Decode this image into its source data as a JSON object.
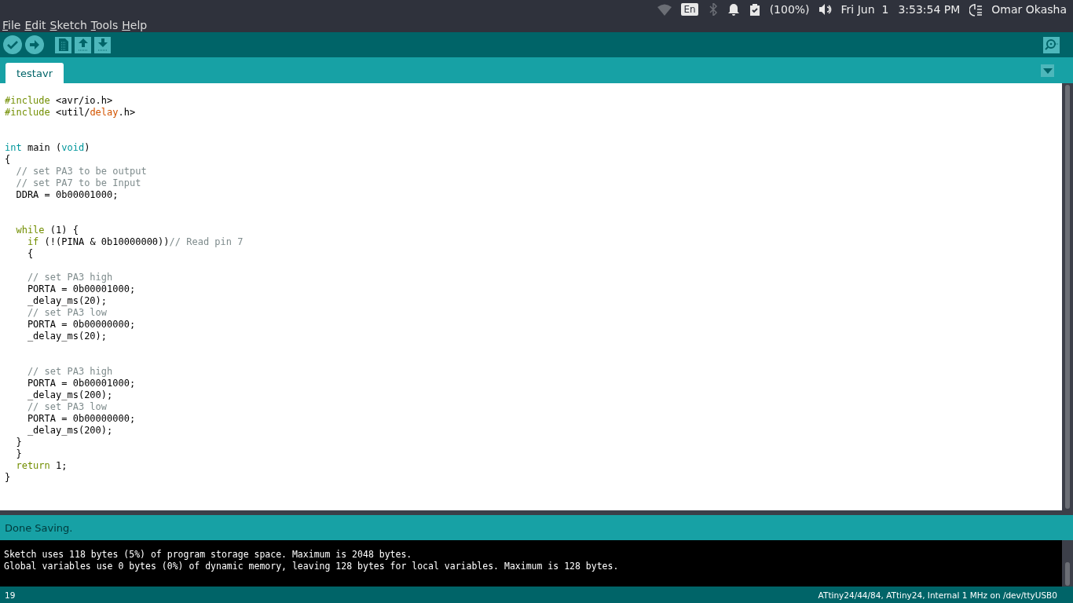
{
  "top_panel": {
    "menu": [
      "File",
      "Edit",
      "Sketch",
      "Tools",
      "Help"
    ],
    "keyboard_layout": "En",
    "battery": "(100%)",
    "date": "Fri Jun  1",
    "time": "3:53:54 PM",
    "user": "Omar Okasha"
  },
  "tabs": [
    {
      "label": "testavr",
      "selected": true
    }
  ],
  "editor": {
    "lines": [
      {
        "kind": "code",
        "tokens": [
          {
            "t": "#include",
            "kind": "keyword"
          },
          {
            "t": " <avr/io.h>",
            "kind": "plain"
          }
        ]
      },
      {
        "kind": "code",
        "tokens": [
          {
            "t": "#include",
            "kind": "keyword"
          },
          {
            "t": " <util/",
            "kind": "plain"
          },
          {
            "t": "delay",
            "kind": "lib"
          },
          {
            "t": ".h>",
            "kind": "plain"
          }
        ]
      },
      {
        "kind": "blank"
      },
      {
        "kind": "blank"
      },
      {
        "kind": "code",
        "tokens": [
          {
            "t": "int",
            "kind": "type"
          },
          {
            "t": " main (",
            "kind": "plain"
          },
          {
            "t": "void",
            "kind": "type"
          },
          {
            "t": ")",
            "kind": "plain"
          }
        ]
      },
      {
        "kind": "code",
        "tokens": [
          {
            "t": "{",
            "kind": "plain"
          }
        ]
      },
      {
        "kind": "code",
        "tokens": [
          {
            "t": "  // set PA3 to be output",
            "kind": "comment"
          }
        ]
      },
      {
        "kind": "code",
        "tokens": [
          {
            "t": "  // set PA7 to be Input",
            "kind": "comment"
          }
        ]
      },
      {
        "kind": "code",
        "tokens": [
          {
            "t": "  DDRA = 0b00001000;",
            "kind": "plain"
          }
        ]
      },
      {
        "kind": "blank"
      },
      {
        "kind": "blank"
      },
      {
        "kind": "code",
        "tokens": [
          {
            "t": "  while",
            "kind": "keyword"
          },
          {
            "t": " (1) {",
            "kind": "plain"
          }
        ]
      },
      {
        "kind": "code",
        "tokens": [
          {
            "t": "    if",
            "kind": "keyword"
          },
          {
            "t": " (!(PINA & 0b10000000))",
            "kind": "plain"
          },
          {
            "t": "// Read pin 7",
            "kind": "comment"
          }
        ]
      },
      {
        "kind": "code",
        "tokens": [
          {
            "t": "    {",
            "kind": "plain"
          }
        ]
      },
      {
        "kind": "blank"
      },
      {
        "kind": "code",
        "tokens": [
          {
            "t": "    // set PA3 high",
            "kind": "comment"
          }
        ]
      },
      {
        "kind": "code",
        "tokens": [
          {
            "t": "    PORTA = 0b00001000;",
            "kind": "plain"
          }
        ]
      },
      {
        "kind": "code",
        "tokens": [
          {
            "t": "    _delay_ms(20);",
            "kind": "plain"
          }
        ]
      },
      {
        "kind": "code",
        "tokens": [
          {
            "t": "    // set PA3 low",
            "kind": "comment"
          }
        ]
      },
      {
        "kind": "code",
        "tokens": [
          {
            "t": "    PORTA = 0b00000000;",
            "kind": "plain"
          }
        ]
      },
      {
        "kind": "code",
        "tokens": [
          {
            "t": "    _delay_ms(20);",
            "kind": "plain"
          }
        ]
      },
      {
        "kind": "blank"
      },
      {
        "kind": "blank"
      },
      {
        "kind": "code",
        "tokens": [
          {
            "t": "    // set PA3 high",
            "kind": "comment"
          }
        ]
      },
      {
        "kind": "code",
        "tokens": [
          {
            "t": "    PORTA = 0b00001000;",
            "kind": "plain"
          }
        ]
      },
      {
        "kind": "code",
        "tokens": [
          {
            "t": "    _delay_ms(200);",
            "kind": "plain"
          }
        ]
      },
      {
        "kind": "code",
        "tokens": [
          {
            "t": "    // set PA3 low",
            "kind": "comment"
          }
        ]
      },
      {
        "kind": "code",
        "tokens": [
          {
            "t": "    PORTA = 0b00000000;",
            "kind": "plain"
          }
        ]
      },
      {
        "kind": "code",
        "tokens": [
          {
            "t": "    _delay_ms(200);",
            "kind": "plain"
          }
        ]
      },
      {
        "kind": "code",
        "tokens": [
          {
            "t": "  }",
            "kind": "plain"
          }
        ]
      },
      {
        "kind": "code",
        "tokens": [
          {
            "t": "  }",
            "kind": "plain"
          }
        ]
      },
      {
        "kind": "code",
        "tokens": [
          {
            "t": "  return",
            "kind": "keyword"
          },
          {
            "t": " 1;",
            "kind": "plain"
          }
        ]
      },
      {
        "kind": "code",
        "tokens": [
          {
            "t": "}",
            "kind": "plain"
          }
        ]
      }
    ]
  },
  "status_message": "Done Saving.",
  "console": [
    "Sketch uses 118 bytes (5%) of program storage space. Maximum is 2048 bytes.",
    "Global variables use 0 bytes (0%) of dynamic memory, leaving 128 bytes for local variables. Maximum is 128 bytes."
  ],
  "status_bar": {
    "line_number": "19",
    "board": "ATtiny24/44/84, ATtiny24, Internal 1 MHz on /dev/ttyUSB0"
  }
}
